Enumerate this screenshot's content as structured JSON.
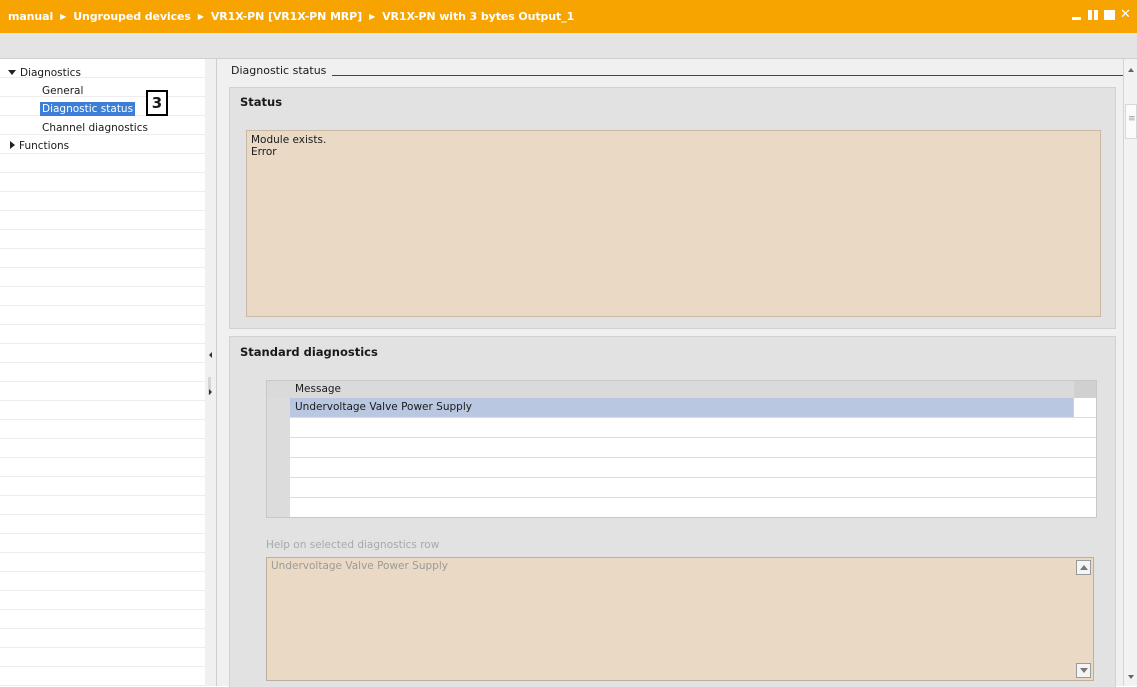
{
  "titlebar": {
    "breadcrumb": [
      "manual",
      "Ungrouped devices",
      "VR1X-PN [VR1X-PN MRP]",
      "VR1X-PN with 3 bytes Output_1"
    ],
    "separator_icon": "triangle-right",
    "window_controls": [
      "minimize-icon",
      "tile-icon",
      "maximize-icon",
      "close-icon"
    ],
    "close_glyph": "✕",
    "color": "#f7a300"
  },
  "tree": {
    "items": [
      {
        "label": "Diagnostics",
        "expanded": true,
        "level": 0
      },
      {
        "label": "General",
        "level": 1
      },
      {
        "label": "Diagnostic status",
        "level": 1,
        "selected": true
      },
      {
        "label": "Channel diagnostics",
        "level": 1
      },
      {
        "label": "Functions",
        "expanded": false,
        "level": 0
      }
    ],
    "callout": "3",
    "selection_color": "#3d7fd6"
  },
  "content": {
    "section_title": "Diagnostic status",
    "status": {
      "heading": "Status",
      "lines": [
        "Module exists.",
        "Error"
      ]
    },
    "standard": {
      "heading": "Standard diagnostics",
      "column_header": "Message",
      "rows": [
        "Undervoltage Valve Power Supply",
        "",
        "",
        "",
        ""
      ],
      "help_label": "Help on selected diagnostics row",
      "help_text": "Undervoltage Valve Power Supply"
    }
  }
}
